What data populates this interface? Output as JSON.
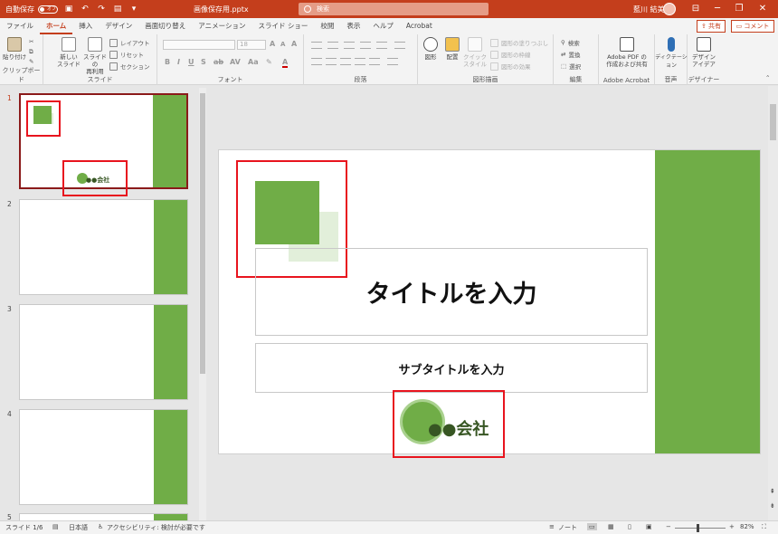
{
  "titlebar": {
    "autosave_label": "自動保存",
    "autosave_state": "オフ",
    "filename": "画像保存用.pptx",
    "search_placeholder": "検索",
    "user_name": "藍川 結美",
    "minimize": "─",
    "restore": "❐",
    "close": "✕"
  },
  "tabs": [
    "ファイル",
    "ホーム",
    "挿入",
    "デザイン",
    "画面切り替え",
    "アニメーション",
    "スライド ショー",
    "校閲",
    "表示",
    "ヘルプ",
    "Acrobat"
  ],
  "tab_active": "ホーム",
  "share_label": "共有",
  "comment_label": "コメント",
  "ribbon": {
    "clipboard": {
      "label": "クリップボード",
      "paste": "貼り付け"
    },
    "slides": {
      "label": "スライド",
      "new_slide_1": "新しい",
      "new_slide_2": "スライド",
      "reuse_1": "スライドの",
      "reuse_2": "再利用",
      "layout": "レイアウト",
      "reset": "リセット",
      "section": "セクション"
    },
    "font": {
      "label": "フォント",
      "size": "18"
    },
    "paragraph": {
      "label": "段落"
    },
    "drawing": {
      "label": "図形描画",
      "shapes": "図形",
      "arrange": "配置",
      "quick_1": "クイック",
      "quick_2": "スタイル",
      "fill": "図形の塗りつぶし",
      "outline": "図形の枠線",
      "effects": "図形の効果"
    },
    "editing": {
      "label": "編集",
      "find": "検索",
      "replace": "置換",
      "select": "選択"
    },
    "acrobat": {
      "label": "Adobe Acrobat",
      "line1": "Adobe PDF の",
      "line2": "作成および共有"
    },
    "voice": {
      "label": "音声",
      "dictate": "ディクテーション"
    },
    "designer": {
      "label": "デザイナー",
      "line1": "デザイン",
      "line2": "アイデア"
    }
  },
  "thumbnails": [
    {
      "number": "1",
      "logo_text": "●●会社"
    },
    {
      "number": "2"
    },
    {
      "number": "3"
    },
    {
      "number": "4"
    },
    {
      "number": "5"
    }
  ],
  "slide": {
    "title": "タイトルを入力",
    "subtitle": "サブタイトルを入力",
    "logo_text": "●●会社"
  },
  "status": {
    "slide_count": "スライド 1/6",
    "language": "日本語",
    "accessibility": "アクセシビリティ: 検討が必要です",
    "notes": "ノート",
    "zoom": "82%"
  },
  "colors": {
    "accent": "#c43e1c",
    "green": "#70ad47",
    "light_green": "#e2efda",
    "dark_green": "#375623",
    "highlight": "#e8141e"
  }
}
